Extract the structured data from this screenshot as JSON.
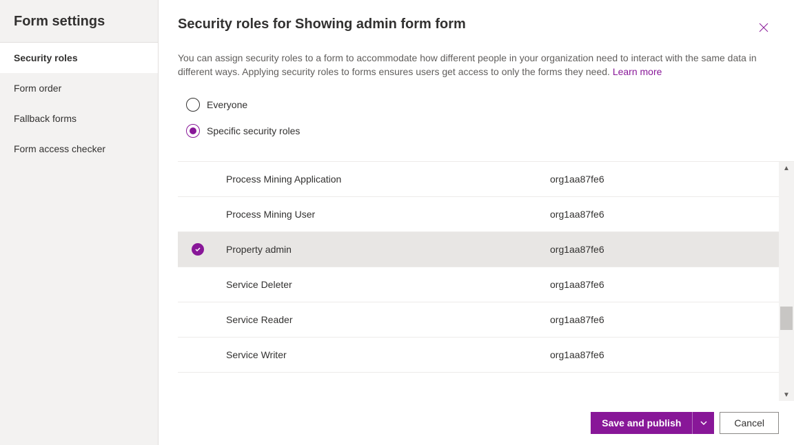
{
  "sidebar": {
    "header": "Form settings",
    "items": [
      {
        "label": "Security roles",
        "active": true
      },
      {
        "label": "Form order",
        "active": false
      },
      {
        "label": "Fallback forms",
        "active": false
      },
      {
        "label": "Form access checker",
        "active": false
      }
    ]
  },
  "panel": {
    "title": "Security roles for Showing admin form form",
    "description": "You can assign security roles to a form to accommodate how different people in your organization need to interact with the same data in different ways. Applying security roles to forms ensures users get access to only the forms they need. ",
    "learn_more": "Learn more"
  },
  "radios": {
    "everyone": "Everyone",
    "specific": "Specific security roles",
    "selected": "specific"
  },
  "roles": [
    {
      "name": "Process Mining Application",
      "org": "org1aa87fe6",
      "selected": false
    },
    {
      "name": "Process Mining User",
      "org": "org1aa87fe6",
      "selected": false
    },
    {
      "name": "Property admin",
      "org": "org1aa87fe6",
      "selected": true
    },
    {
      "name": "Service Deleter",
      "org": "org1aa87fe6",
      "selected": false
    },
    {
      "name": "Service Reader",
      "org": "org1aa87fe6",
      "selected": false
    },
    {
      "name": "Service Writer",
      "org": "org1aa87fe6",
      "selected": false
    }
  ],
  "footer": {
    "save": "Save and publish",
    "cancel": "Cancel"
  }
}
